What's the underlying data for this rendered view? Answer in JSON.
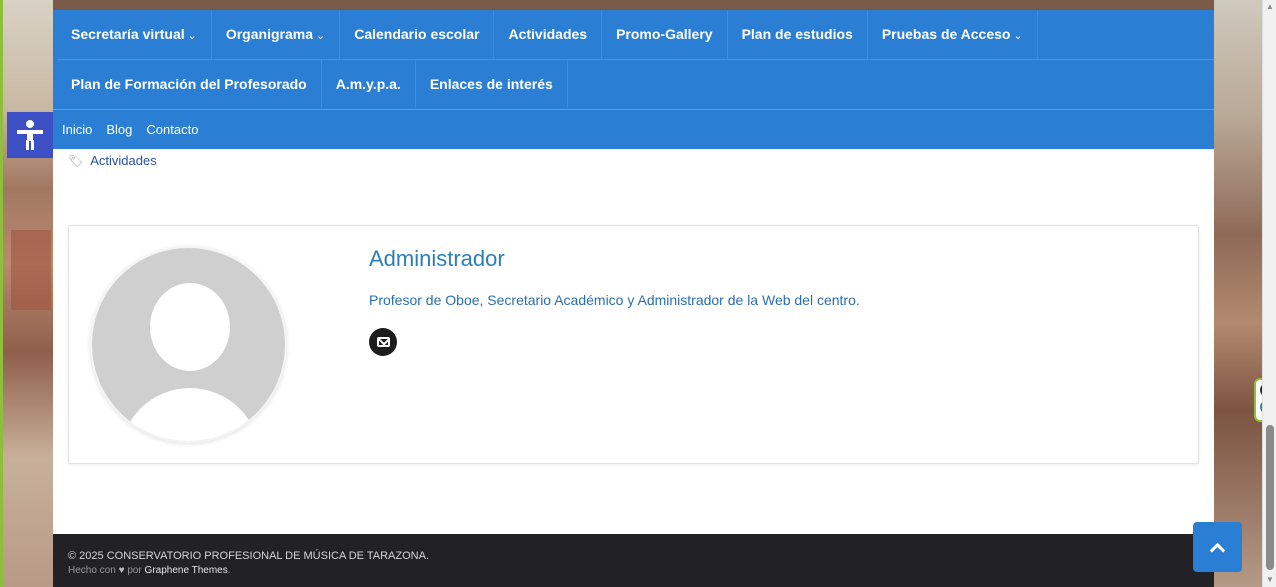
{
  "nav": {
    "row1": [
      {
        "label": "Secretaría virtual",
        "caret": "⌄"
      },
      {
        "label": "Organigrama",
        "caret": "⌄"
      },
      {
        "label": "Calendario escolar",
        "caret": ""
      },
      {
        "label": "Actividades",
        "caret": ""
      },
      {
        "label": "Promo-Gallery",
        "caret": ""
      },
      {
        "label": "Plan de estudios",
        "caret": ""
      },
      {
        "label": "Pruebas de Acceso",
        "caret": "⌄"
      }
    ],
    "row2": [
      {
        "label": "Plan de Formación del Profesorado"
      },
      {
        "label": "A.m.y.p.a."
      },
      {
        "label": "Enlaces de interés"
      }
    ]
  },
  "subnav": [
    "Inicio",
    "Blog",
    "Contacto"
  ],
  "breadcrumb": {
    "icon": "tags-icon",
    "label": "Actividades"
  },
  "author": {
    "name": "Administrador",
    "bio": "Profesor de Oboe, Secretario Académico y Administrador de la Web del centro.",
    "contact_icon": "envelope-icon"
  },
  "footer": {
    "copyright": "© 2025 CONSERVATORIO PROFESIONAL DE MÚSICA DE TARAZONA.",
    "made_prefix": "Hecho con",
    "made_by": "por",
    "theme": "Graphene Themes",
    "theme_suffix": "."
  },
  "colors": {
    "nav_bg": "#2a7fd4",
    "footer_bg": "#222125",
    "a11y_bg": "#3d4fc4",
    "link": "#2a7fb8"
  },
  "widgets": {
    "accessibility_icon": "accessibility-icon",
    "back_to_top_icon": "chevron-up-icon",
    "side_close_icon": "close-icon",
    "side_e_icon": "e-icon"
  }
}
